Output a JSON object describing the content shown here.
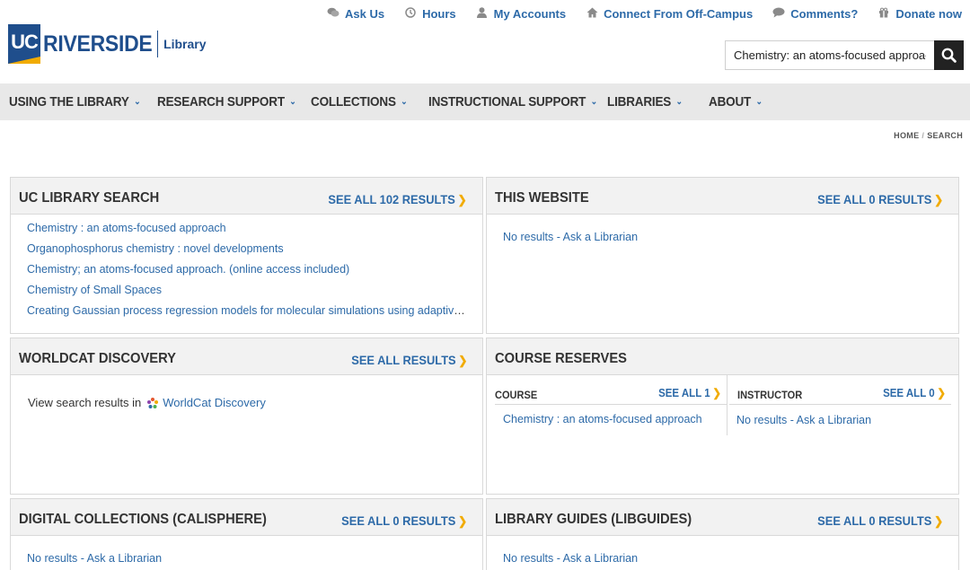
{
  "header": {
    "logo_uc": "UC",
    "logo_riverside": "RIVERSIDE",
    "logo_library": "Library",
    "utility": [
      {
        "label": "Ask Us",
        "icon": "chat-icon"
      },
      {
        "label": "Hours",
        "icon": "clock-icon"
      },
      {
        "label": "My Accounts",
        "icon": "user-icon"
      },
      {
        "label": "Connect From Off-Campus",
        "icon": "home-icon"
      },
      {
        "label": "Comments?",
        "icon": "comment-icon"
      },
      {
        "label": "Donate now",
        "icon": "gift-icon"
      }
    ],
    "search": {
      "value": "Chemistry: an atoms-focused approach",
      "icon": "search-icon"
    }
  },
  "nav": {
    "items": [
      {
        "label": "USING THE LIBRARY"
      },
      {
        "label": "RESEARCH SUPPORT"
      },
      {
        "label": "COLLECTIONS"
      },
      {
        "label": "INSTRUCTIONAL SUPPORT"
      },
      {
        "label": "LIBRARIES"
      },
      {
        "label": "ABOUT"
      }
    ]
  },
  "breadcrumb": {
    "home": "HOME",
    "separator": "/",
    "current": "SEARCH"
  },
  "panels": {
    "uc_library": {
      "title": "UC LIBRARY SEARCH",
      "see_all": "SEE ALL 102 RESULTS",
      "results": [
        "Chemistry : an atoms-focused approach",
        "Organophosphorus chemistry : novel developments",
        "Chemistry; an atoms-focused approach. (online access included)",
        "Chemistry of Small Spaces",
        "Creating Gaussian process regression models for molecular simulations using adaptive sampling"
      ]
    },
    "website": {
      "title": "THIS WEBSITE",
      "see_all": "SEE ALL 0 RESULTS",
      "no_results": "No results - Ask a Librarian"
    },
    "worldcat": {
      "title": "WORLDCAT DISCOVERY",
      "see_all": "SEE ALL RESULTS",
      "prefix": "View search results in",
      "link": "WorldCat Discovery"
    },
    "course_reserves": {
      "title": "COURSE RESERVES",
      "course": {
        "title": "COURSE",
        "see_all": "SEE ALL 1",
        "result": "Chemistry : an atoms-focused approach"
      },
      "instructor": {
        "title": "INSTRUCTOR",
        "see_all": "SEE ALL 0",
        "result": "No results - Ask a Librarian"
      }
    },
    "digital": {
      "title": "DIGITAL COLLECTIONS (CALISPHERE)",
      "see_all": "SEE ALL 0 RESULTS",
      "no_results": "No results - Ask a Librarian"
    },
    "guides": {
      "title": "LIBRARY GUIDES (LIBGUIDES)",
      "see_all": "SEE ALL 0 RESULTS",
      "no_results": "No results - Ask a Librarian"
    }
  },
  "colors": {
    "brand_blue": "#1f4e8c",
    "link_blue": "#2d6aa8",
    "accent_gold": "#f1ab00",
    "nav_bg": "#e8e8e8"
  }
}
